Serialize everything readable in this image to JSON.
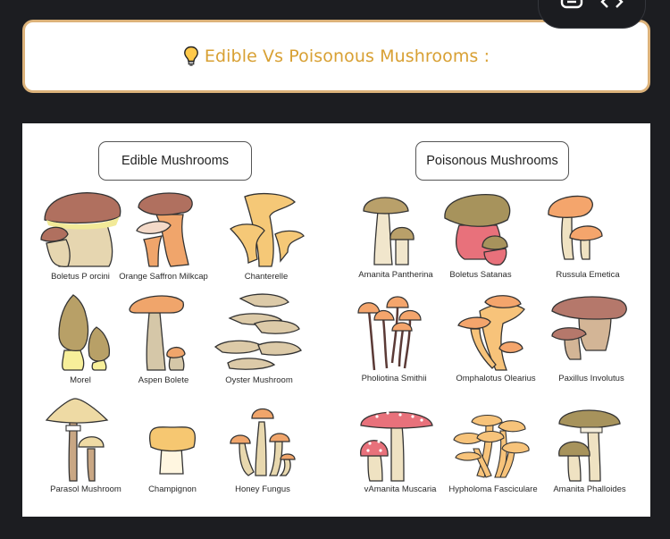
{
  "toolbar": {
    "buttons": [
      {
        "name": "copy-link",
        "icon": "link-icon"
      },
      {
        "name": "view-code",
        "icon": "code-icon"
      }
    ]
  },
  "title_box": {
    "icon": "lightbulb-icon",
    "text": "Edible Vs Poisonous Mushrooms :"
  },
  "figure": {
    "edible": {
      "heading": "Edible Mushrooms",
      "items": [
        {
          "label": "Boletus P orcini"
        },
        {
          "label": "Orange Saffron Milkcap"
        },
        {
          "label": "Chanterelle"
        },
        {
          "label": "Morel"
        },
        {
          "label": "Aspen Bolete"
        },
        {
          "label": "Oyster Mushroom"
        },
        {
          "label": "Parasol Mushroom"
        },
        {
          "label": "Champignon"
        },
        {
          "label": "Honey Fungus"
        }
      ]
    },
    "poisonous": {
      "heading": "Poisonous Mushrooms",
      "items": [
        {
          "label": "Amanita Pantherina"
        },
        {
          "label": "Boletus Satanas"
        },
        {
          "label": "Russula Emetica"
        },
        {
          "label": "Pholiotina Smithii"
        },
        {
          "label": "Omphalotus Olearius"
        },
        {
          "label": "Paxillus Involutus"
        },
        {
          "label": "vAmanita Muscaria"
        },
        {
          "label": "Hypholoma Fasciculare"
        },
        {
          "label": "Amanita Phalloides"
        }
      ]
    }
  },
  "colors": {
    "page_bg": "#1c1d21",
    "title_border": "#dcb27a",
    "title_text": "#d8a033"
  }
}
